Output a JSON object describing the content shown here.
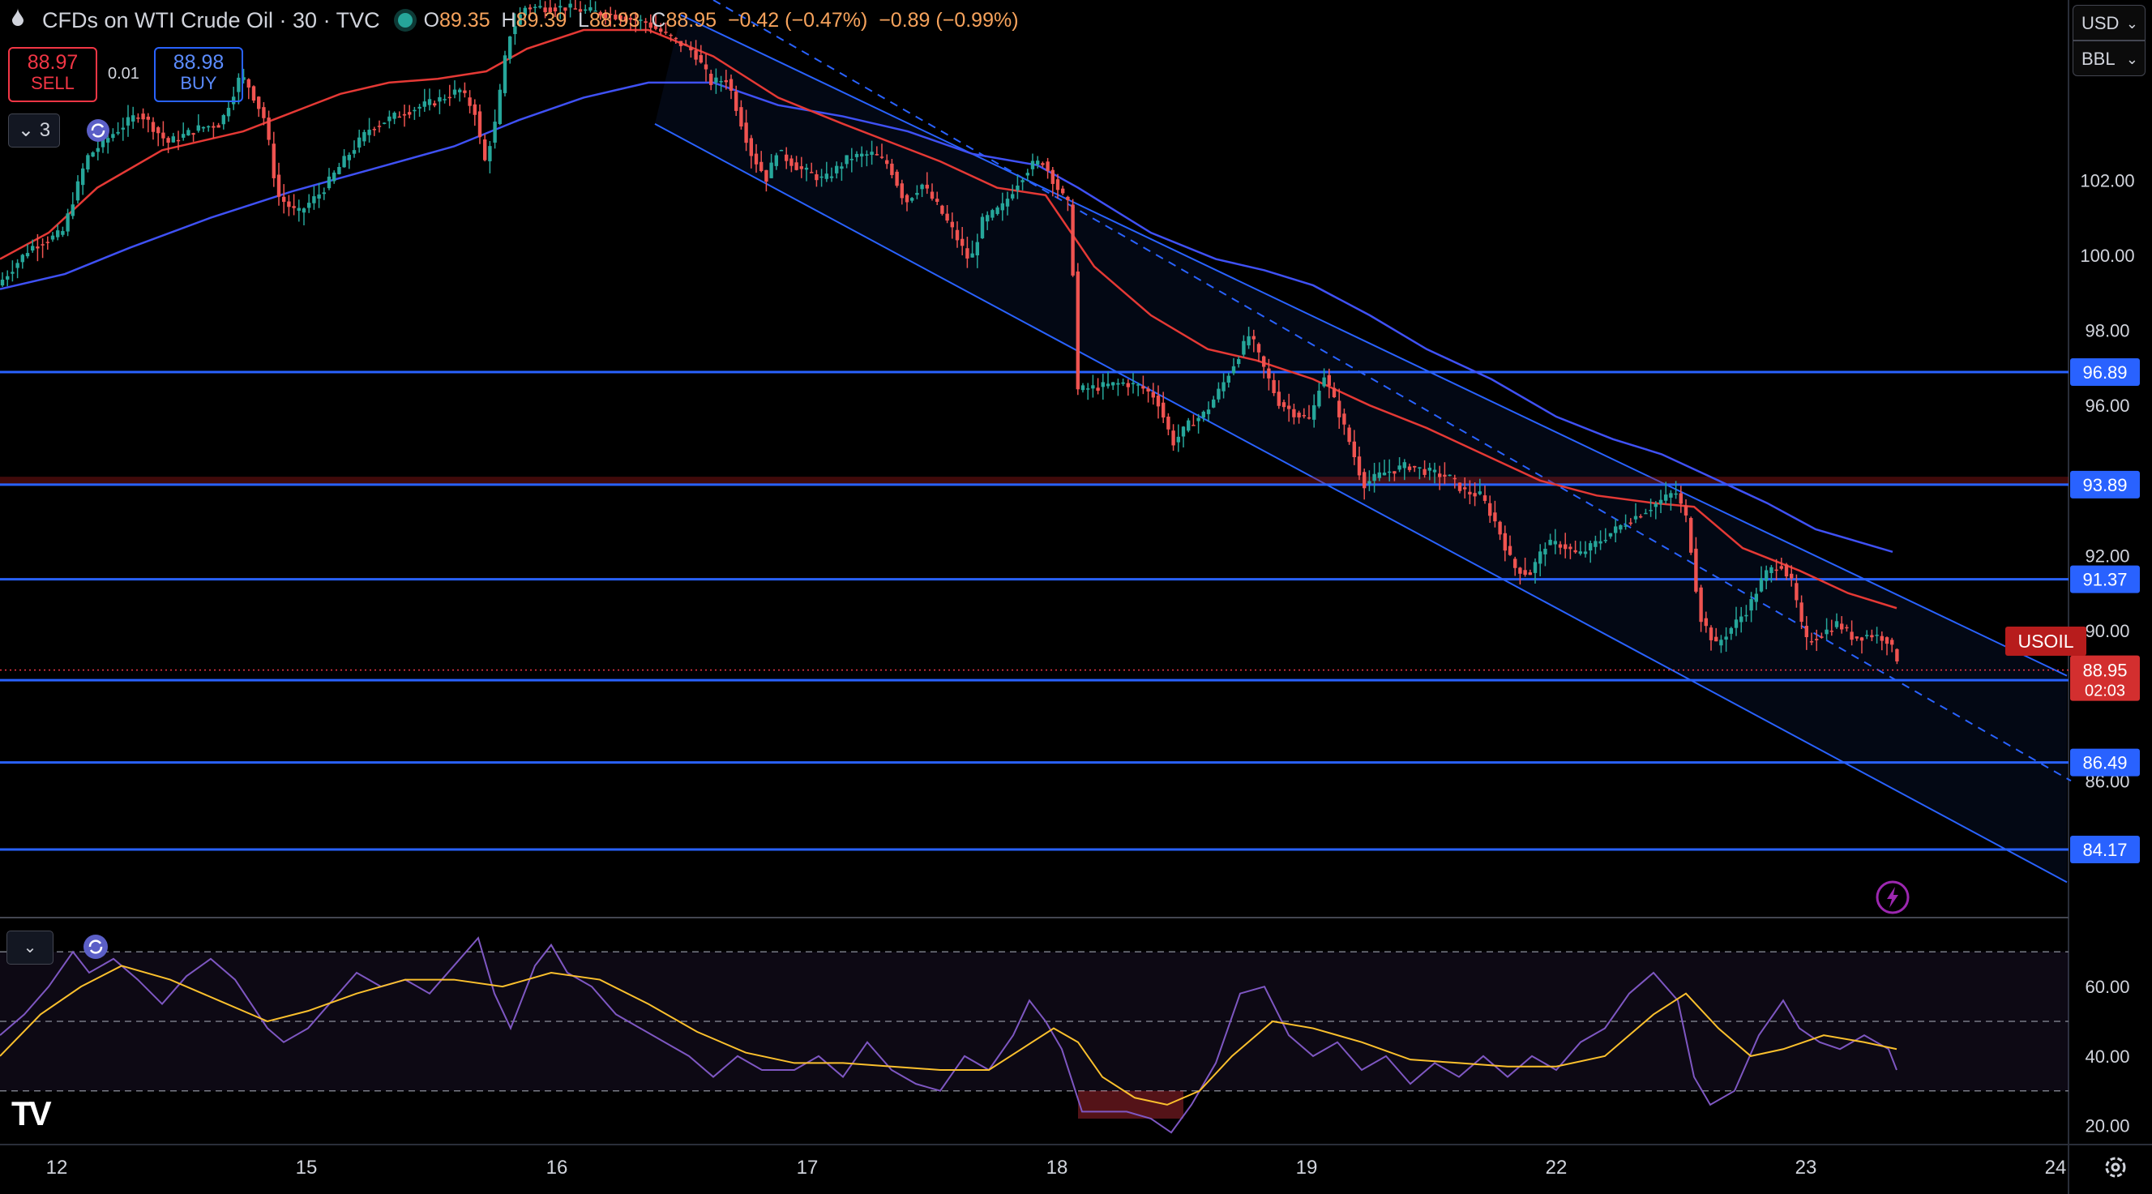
{
  "header": {
    "symbol": "CFDs on WTI Crude Oil · 30 · TVC",
    "o_label": "O",
    "o_value": "89.35",
    "h_label": "H",
    "h_value": "89.39",
    "l_label": "L",
    "l_value": "88.93",
    "c_label": "C",
    "c_value": "88.95",
    "change": "−0.42 (−0.47%)",
    "change2": "−0.89 (−0.99%)"
  },
  "trade": {
    "sell_price": "88.97",
    "sell_label": "SELL",
    "buy_price": "88.98",
    "buy_label": "BUY",
    "spread": "0.01"
  },
  "indicators_button": "3",
  "currency": "USD",
  "unit": "BBL",
  "symbol_tag": "USOIL",
  "colors": {
    "up": "#26a69a",
    "down": "#ef5350",
    "ma_fast": "#e53935",
    "ma_slow": "#3f51f5",
    "level": "#2962ff",
    "rsi": "#7e57c2",
    "rsi_ma": "#fbc02d",
    "price": "#f23645"
  },
  "chart_data": {
    "type": "candlestick",
    "ylim": [
      82.4,
      106.8
    ],
    "y_ticks": [
      "102.00",
      "100.00",
      "98.00",
      "96.00",
      "92.00",
      "90.00",
      "86.00"
    ],
    "x_ticks": [
      "12",
      "15",
      "16",
      "17",
      "18",
      "19",
      "22",
      "23",
      "24"
    ],
    "levels": [
      {
        "value": 96.89,
        "label": "96.89"
      },
      {
        "value": 93.89,
        "label": "93.89"
      },
      {
        "value": 91.37,
        "label": "91.37"
      },
      {
        "value": 88.68,
        "label": "88.68"
      },
      {
        "value": 86.49,
        "label": "86.49"
      },
      {
        "value": 84.17,
        "label": "84.17"
      }
    ],
    "last_price": {
      "value": 88.95,
      "label": "88.95",
      "countdown": "02:03"
    },
    "price_path": [
      [
        0,
        99.2
      ],
      [
        40,
        100.2
      ],
      [
        80,
        100.6
      ],
      [
        110,
        102.6
      ],
      [
        140,
        103.2
      ],
      [
        175,
        103.8
      ],
      [
        210,
        103.0
      ],
      [
        250,
        103.4
      ],
      [
        275,
        103.5
      ],
      [
        300,
        104.8
      ],
      [
        310,
        104.5
      ],
      [
        330,
        103.6
      ],
      [
        345,
        101.6
      ],
      [
        370,
        101.1
      ],
      [
        400,
        101.7
      ],
      [
        430,
        102.6
      ],
      [
        460,
        103.4
      ],
      [
        500,
        103.8
      ],
      [
        540,
        104.1
      ],
      [
        570,
        104.4
      ],
      [
        590,
        103.8
      ],
      [
        600,
        102.4
      ],
      [
        615,
        103.6
      ],
      [
        630,
        105.8
      ],
      [
        650,
        106.6
      ],
      [
        700,
        106.6
      ],
      [
        760,
        106.4
      ],
      [
        800,
        106.2
      ],
      [
        830,
        105.8
      ],
      [
        860,
        105.4
      ],
      [
        880,
        104.6
      ],
      [
        900,
        104.7
      ],
      [
        930,
        102.7
      ],
      [
        950,
        102.0
      ],
      [
        960,
        102.8
      ],
      [
        990,
        102.3
      ],
      [
        1020,
        102.0
      ],
      [
        1050,
        102.6
      ],
      [
        1080,
        102.7
      ],
      [
        1100,
        102.4
      ],
      [
        1120,
        101.4
      ],
      [
        1140,
        101.9
      ],
      [
        1160,
        101.3
      ],
      [
        1180,
        100.6
      ],
      [
        1200,
        99.8
      ],
      [
        1215,
        100.9
      ],
      [
        1240,
        101.3
      ],
      [
        1260,
        102.0
      ],
      [
        1275,
        102.4
      ],
      [
        1290,
        102.5
      ],
      [
        1310,
        101.7
      ],
      [
        1325,
        101.2
      ],
      [
        1330,
        96.4
      ],
      [
        1360,
        96.5
      ],
      [
        1390,
        96.6
      ],
      [
        1410,
        96.5
      ],
      [
        1430,
        96.2
      ],
      [
        1450,
        95.0
      ],
      [
        1470,
        95.5
      ],
      [
        1490,
        95.8
      ],
      [
        1510,
        96.5
      ],
      [
        1530,
        97.3
      ],
      [
        1545,
        97.9
      ],
      [
        1560,
        97.1
      ],
      [
        1580,
        96.1
      ],
      [
        1600,
        95.8
      ],
      [
        1620,
        95.6
      ],
      [
        1635,
        96.9
      ],
      [
        1655,
        95.8
      ],
      [
        1670,
        94.9
      ],
      [
        1685,
        93.9
      ],
      [
        1710,
        94.2
      ],
      [
        1740,
        94.4
      ],
      [
        1770,
        94.2
      ],
      [
        1790,
        94.1
      ],
      [
        1810,
        93.7
      ],
      [
        1830,
        93.6
      ],
      [
        1850,
        92.8
      ],
      [
        1870,
        91.7
      ],
      [
        1890,
        91.5
      ],
      [
        1910,
        92.3
      ],
      [
        1930,
        92.3
      ],
      [
        1950,
        92.0
      ],
      [
        1970,
        92.3
      ],
      [
        1990,
        92.6
      ],
      [
        2010,
        92.9
      ],
      [
        2040,
        93.3
      ],
      [
        2070,
        93.7
      ],
      [
        2085,
        92.9
      ],
      [
        2100,
        90.4
      ],
      [
        2120,
        89.6
      ],
      [
        2140,
        90.1
      ],
      [
        2160,
        90.6
      ],
      [
        2180,
        91.5
      ],
      [
        2200,
        91.8
      ],
      [
        2215,
        91.2
      ],
      [
        2230,
        89.7
      ],
      [
        2250,
        89.9
      ],
      [
        2270,
        90.2
      ],
      [
        2290,
        89.8
      ],
      [
        2310,
        89.9
      ],
      [
        2330,
        89.8
      ],
      [
        2345,
        89.2
      ]
    ],
    "ma_fast": [
      [
        0,
        99.9
      ],
      [
        60,
        100.6
      ],
      [
        120,
        101.8
      ],
      [
        200,
        102.8
      ],
      [
        300,
        103.3
      ],
      [
        360,
        103.8
      ],
      [
        420,
        104.3
      ],
      [
        480,
        104.6
      ],
      [
        540,
        104.7
      ],
      [
        600,
        104.9
      ],
      [
        650,
        105.5
      ],
      [
        720,
        106.0
      ],
      [
        800,
        106.0
      ],
      [
        880,
        105.3
      ],
      [
        960,
        104.2
      ],
      [
        1040,
        103.5
      ],
      [
        1100,
        103.0
      ],
      [
        1160,
        102.5
      ],
      [
        1230,
        101.8
      ],
      [
        1290,
        101.6
      ],
      [
        1350,
        99.7
      ],
      [
        1420,
        98.4
      ],
      [
        1490,
        97.5
      ],
      [
        1550,
        97.2
      ],
      [
        1620,
        96.7
      ],
      [
        1690,
        96.0
      ],
      [
        1760,
        95.4
      ],
      [
        1830,
        94.7
      ],
      [
        1900,
        94.0
      ],
      [
        1970,
        93.6
      ],
      [
        2040,
        93.4
      ],
      [
        2090,
        93.3
      ],
      [
        2150,
        92.2
      ],
      [
        2220,
        91.6
      ],
      [
        2280,
        91.0
      ],
      [
        2340,
        90.6
      ]
    ],
    "ma_slow": [
      [
        0,
        99.1
      ],
      [
        80,
        99.5
      ],
      [
        160,
        100.2
      ],
      [
        260,
        101.0
      ],
      [
        360,
        101.7
      ],
      [
        460,
        102.3
      ],
      [
        560,
        102.9
      ],
      [
        640,
        103.6
      ],
      [
        720,
        104.2
      ],
      [
        800,
        104.6
      ],
      [
        880,
        104.6
      ],
      [
        960,
        104.0
      ],
      [
        1040,
        103.7
      ],
      [
        1120,
        103.3
      ],
      [
        1200,
        102.7
      ],
      [
        1280,
        102.4
      ],
      [
        1330,
        101.8
      ],
      [
        1420,
        100.6
      ],
      [
        1500,
        99.9
      ],
      [
        1560,
        99.6
      ],
      [
        1620,
        99.2
      ],
      [
        1690,
        98.4
      ],
      [
        1760,
        97.5
      ],
      [
        1840,
        96.7
      ],
      [
        1920,
        95.7
      ],
      [
        1990,
        95.1
      ],
      [
        2050,
        94.7
      ],
      [
        2110,
        94.1
      ],
      [
        2180,
        93.4
      ],
      [
        2240,
        92.7
      ],
      [
        2335,
        92.1
      ]
    ],
    "channel": {
      "upper": [
        [
          840,
          106.4
        ],
        [
          2550,
          88.8
        ]
      ],
      "mid": [
        [
          880,
          106.8
        ],
        [
          2555,
          86.0
        ]
      ],
      "lower": [
        [
          808,
          103.5
        ],
        [
          2550,
          83.3
        ]
      ]
    },
    "rsi": {
      "ylim": [
        15,
        78
      ],
      "y_ticks": [
        "60.00",
        "40.00",
        "20.00"
      ],
      "bands": [
        70,
        50,
        30
      ],
      "values": [
        [
          0,
          46
        ],
        [
          30,
          52
        ],
        [
          60,
          60
        ],
        [
          90,
          70
        ],
        [
          110,
          64
        ],
        [
          140,
          68
        ],
        [
          170,
          62
        ],
        [
          200,
          55
        ],
        [
          230,
          63
        ],
        [
          260,
          68
        ],
        [
          290,
          62
        ],
        [
          310,
          55
        ],
        [
          330,
          48
        ],
        [
          350,
          44
        ],
        [
          380,
          48
        ],
        [
          410,
          56
        ],
        [
          440,
          64
        ],
        [
          470,
          60
        ],
        [
          500,
          62
        ],
        [
          530,
          58
        ],
        [
          560,
          66
        ],
        [
          590,
          74
        ],
        [
          610,
          58
        ],
        [
          630,
          48
        ],
        [
          660,
          66
        ],
        [
          680,
          72
        ],
        [
          700,
          64
        ],
        [
          730,
          60
        ],
        [
          760,
          52
        ],
        [
          790,
          48
        ],
        [
          820,
          44
        ],
        [
          850,
          40
        ],
        [
          880,
          34
        ],
        [
          910,
          40
        ],
        [
          940,
          36
        ],
        [
          980,
          36
        ],
        [
          1010,
          40
        ],
        [
          1040,
          34
        ],
        [
          1070,
          44
        ],
        [
          1100,
          36
        ],
        [
          1130,
          32
        ],
        [
          1160,
          30
        ],
        [
          1190,
          40
        ],
        [
          1220,
          36
        ],
        [
          1250,
          46
        ],
        [
          1270,
          56
        ],
        [
          1290,
          50
        ],
        [
          1310,
          42
        ],
        [
          1335,
          24
        ],
        [
          1360,
          24
        ],
        [
          1390,
          24
        ],
        [
          1420,
          22
        ],
        [
          1445,
          18
        ],
        [
          1470,
          26
        ],
        [
          1500,
          38
        ],
        [
          1530,
          58
        ],
        [
          1560,
          60
        ],
        [
          1590,
          46
        ],
        [
          1620,
          40
        ],
        [
          1650,
          44
        ],
        [
          1680,
          36
        ],
        [
          1710,
          40
        ],
        [
          1740,
          32
        ],
        [
          1770,
          38
        ],
        [
          1800,
          34
        ],
        [
          1830,
          40
        ],
        [
          1860,
          34
        ],
        [
          1890,
          40
        ],
        [
          1920,
          36
        ],
        [
          1950,
          44
        ],
        [
          1980,
          48
        ],
        [
          2010,
          58
        ],
        [
          2040,
          64
        ],
        [
          2070,
          56
        ],
        [
          2090,
          34
        ],
        [
          2110,
          26
        ],
        [
          2140,
          30
        ],
        [
          2170,
          46
        ],
        [
          2200,
          56
        ],
        [
          2220,
          48
        ],
        [
          2245,
          44
        ],
        [
          2270,
          42
        ],
        [
          2300,
          46
        ],
        [
          2330,
          42
        ],
        [
          2340,
          36
        ]
      ],
      "ma": [
        [
          0,
          40
        ],
        [
          50,
          52
        ],
        [
          100,
          60
        ],
        [
          150,
          66
        ],
        [
          210,
          62
        ],
        [
          270,
          56
        ],
        [
          330,
          50
        ],
        [
          380,
          53
        ],
        [
          440,
          58
        ],
        [
          500,
          62
        ],
        [
          560,
          62
        ],
        [
          620,
          60
        ],
        [
          680,
          64
        ],
        [
          740,
          62
        ],
        [
          800,
          55
        ],
        [
          860,
          47
        ],
        [
          920,
          41
        ],
        [
          980,
          38
        ],
        [
          1040,
          38
        ],
        [
          1100,
          37
        ],
        [
          1160,
          36
        ],
        [
          1220,
          36
        ],
        [
          1260,
          42
        ],
        [
          1300,
          48
        ],
        [
          1330,
          44
        ],
        [
          1360,
          34
        ],
        [
          1400,
          28
        ],
        [
          1440,
          26
        ],
        [
          1480,
          30
        ],
        [
          1520,
          40
        ],
        [
          1570,
          50
        ],
        [
          1620,
          48
        ],
        [
          1680,
          44
        ],
        [
          1740,
          39
        ],
        [
          1800,
          38
        ],
        [
          1860,
          37
        ],
        [
          1920,
          37
        ],
        [
          1980,
          40
        ],
        [
          2040,
          52
        ],
        [
          2080,
          58
        ],
        [
          2120,
          48
        ],
        [
          2160,
          40
        ],
        [
          2200,
          42
        ],
        [
          2250,
          46
        ],
        [
          2300,
          44
        ],
        [
          2340,
          42
        ]
      ]
    }
  }
}
